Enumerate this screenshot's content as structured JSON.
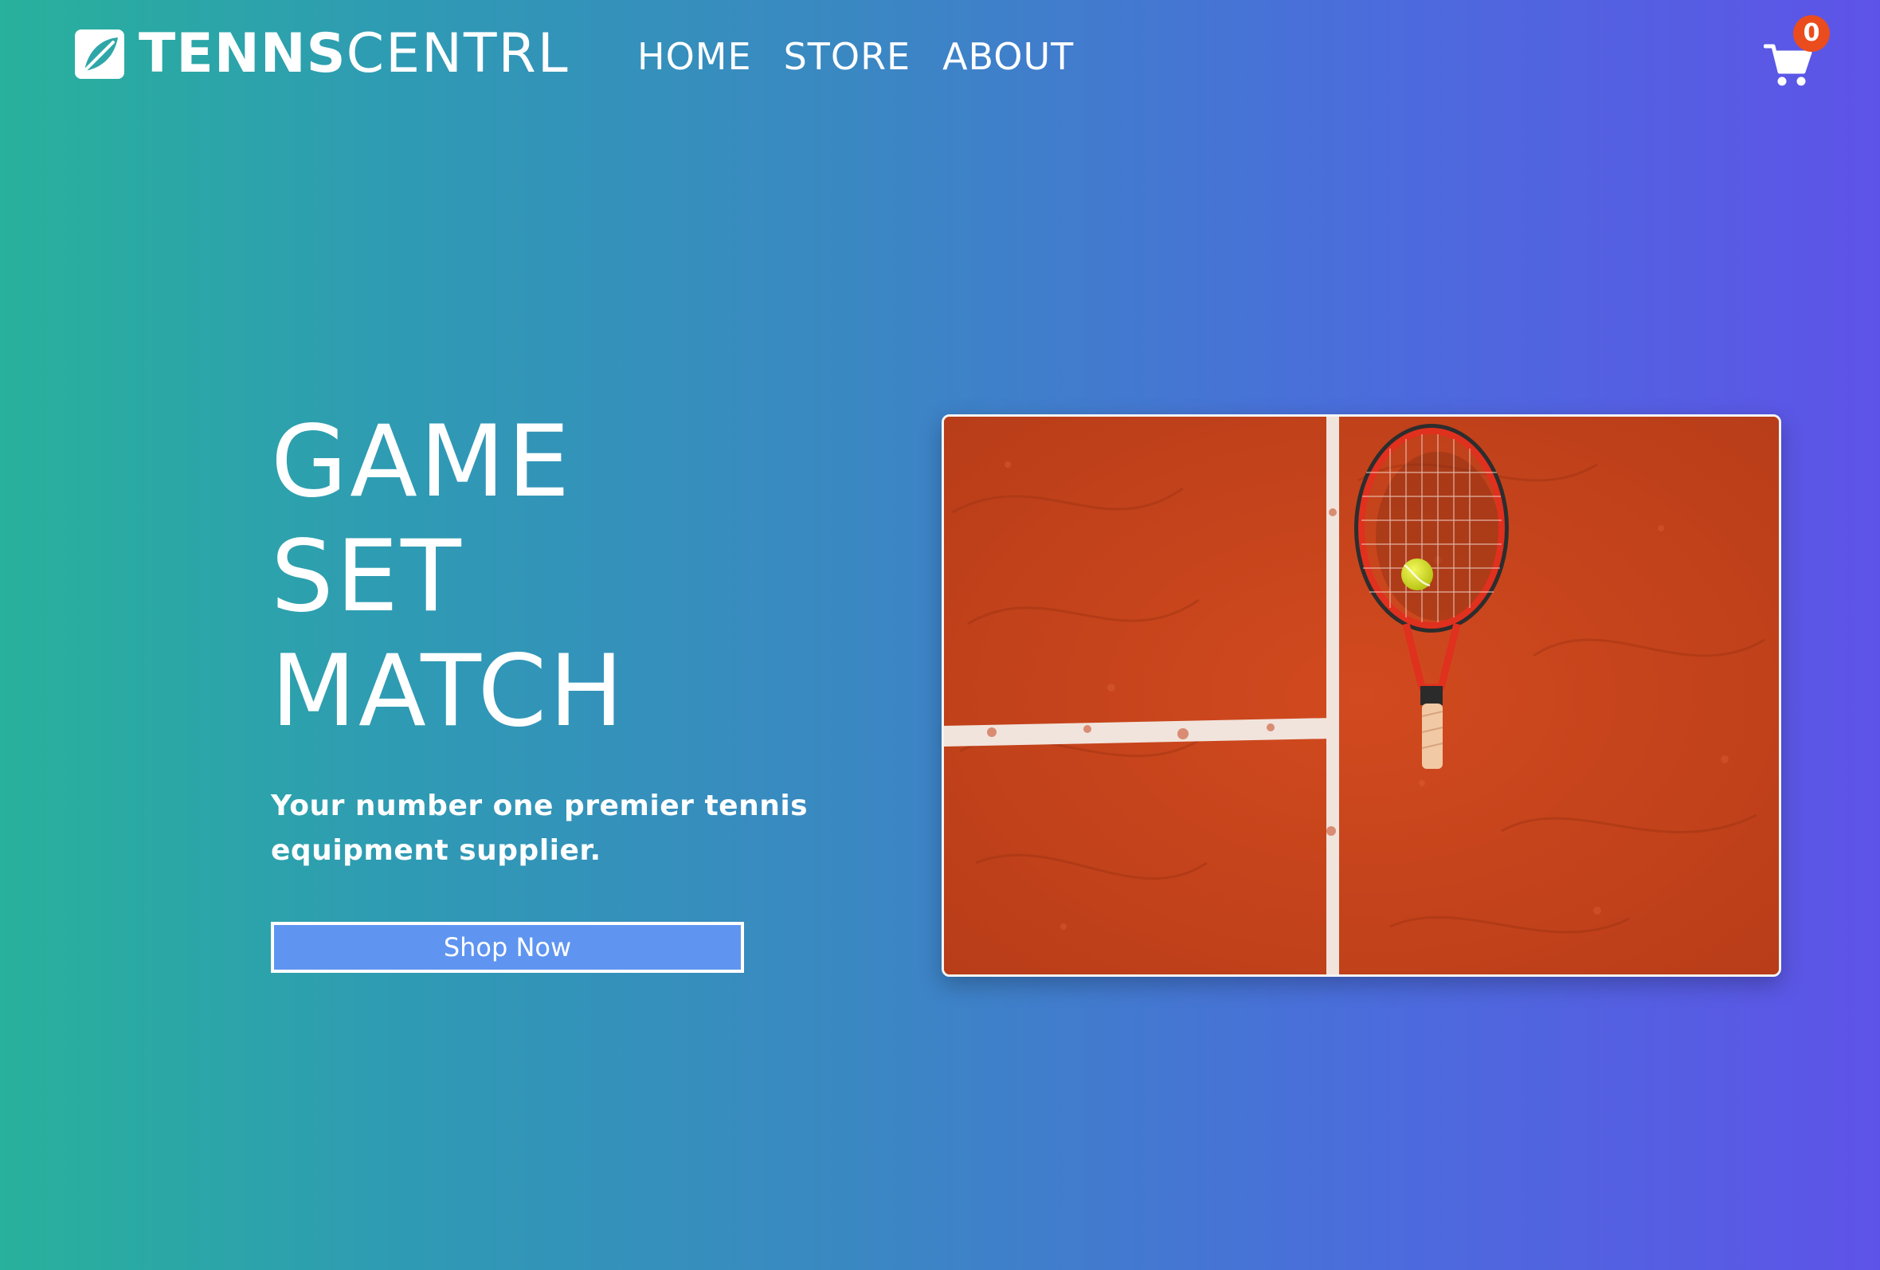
{
  "brand": {
    "name_bold": "TENNS",
    "name_light": "CENTRL",
    "logo_icon": "leaf-logo-icon"
  },
  "nav": {
    "items": [
      {
        "label": "HOME"
      },
      {
        "label": "STORE"
      },
      {
        "label": "ABOUT"
      }
    ]
  },
  "cart": {
    "icon": "shopping-cart-icon",
    "count": "0",
    "badge_color": "#ea4c1d"
  },
  "hero": {
    "title_lines": [
      "GAME",
      "SET",
      "MATCH"
    ],
    "subtitle": "Your number one premier tennis equipment supplier.",
    "cta_label": "Shop Now",
    "cta_color": "#5f95f0",
    "image_subject": "tennis racket and ball on clay court"
  },
  "theme": {
    "gradient_start": "#28b19c",
    "gradient_end": "#5e53e8",
    "clay_color": "#c4441e",
    "ball_color": "#e4ec2c"
  }
}
